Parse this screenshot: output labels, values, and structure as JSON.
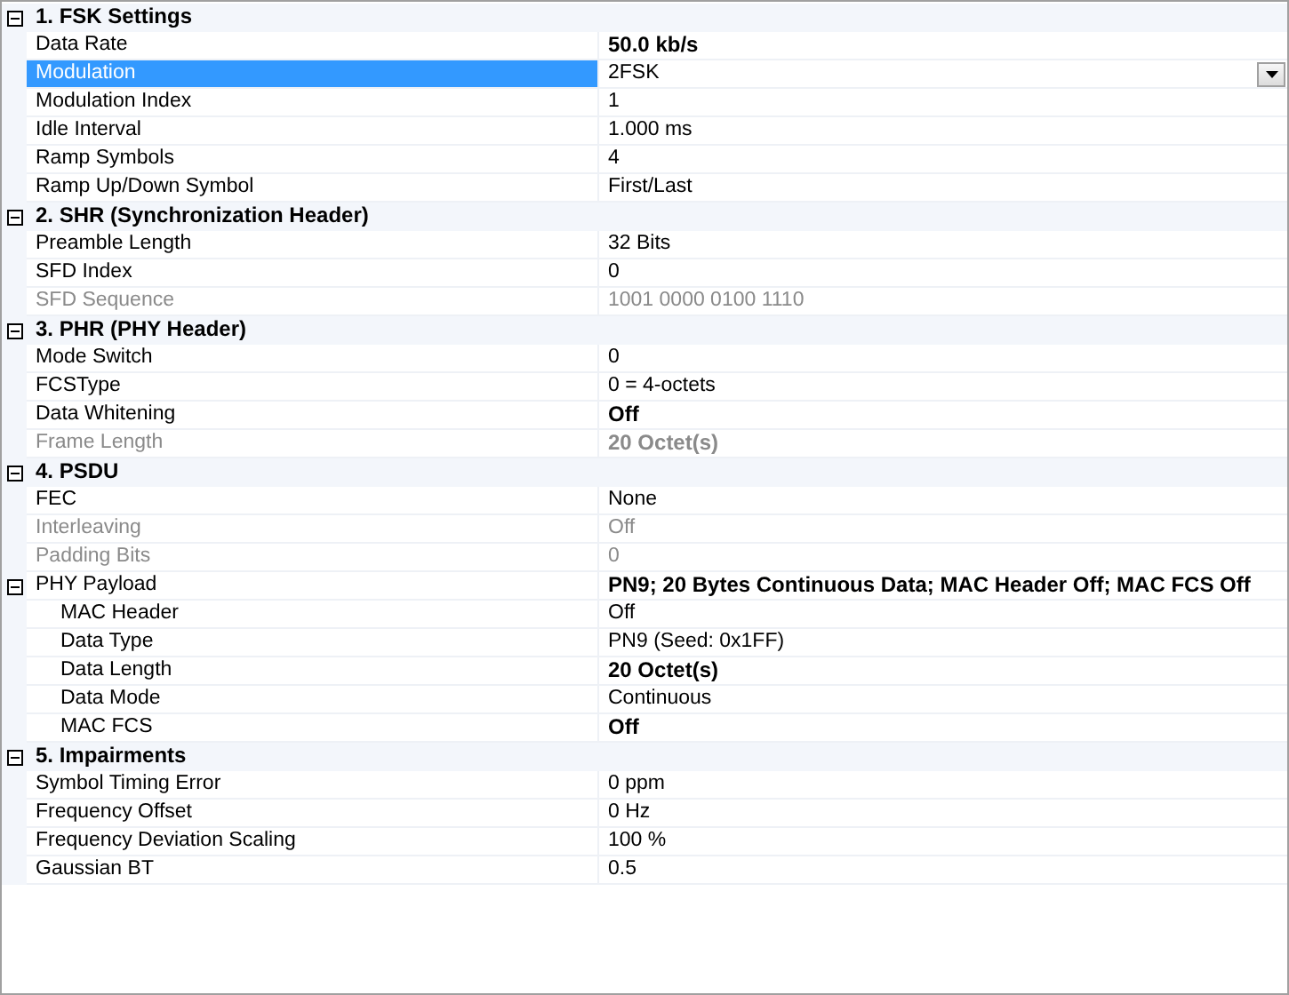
{
  "categories": [
    {
      "title": "1. FSK Settings",
      "expanded": true,
      "properties": [
        {
          "name": "Data Rate",
          "value": "50.0 kb/s",
          "bold": true,
          "disabled": false,
          "selected": false
        },
        {
          "name": "Modulation",
          "value": "2FSK",
          "bold": false,
          "disabled": false,
          "selected": true
        },
        {
          "name": "Modulation Index",
          "value": "1",
          "bold": false,
          "disabled": false,
          "selected": false
        },
        {
          "name": "Idle Interval",
          "value": "1.000 ms",
          "bold": false,
          "disabled": false,
          "selected": false
        },
        {
          "name": "Ramp Symbols",
          "value": "4",
          "bold": false,
          "disabled": false,
          "selected": false
        },
        {
          "name": "Ramp Up/Down Symbol",
          "value": "First/Last",
          "bold": false,
          "disabled": false,
          "selected": false
        }
      ]
    },
    {
      "title": "2. SHR (Synchronization Header)",
      "expanded": true,
      "properties": [
        {
          "name": "Preamble Length",
          "value": "32 Bits",
          "bold": false,
          "disabled": false,
          "selected": false
        },
        {
          "name": "SFD Index",
          "value": "0",
          "bold": false,
          "disabled": false,
          "selected": false
        },
        {
          "name": "SFD Sequence",
          "value": "1001 0000 0100 1110",
          "bold": false,
          "disabled": true,
          "selected": false
        }
      ]
    },
    {
      "title": "3. PHR (PHY Header)",
      "expanded": true,
      "properties": [
        {
          "name": "Mode Switch",
          "value": "0",
          "bold": false,
          "disabled": false,
          "selected": false
        },
        {
          "name": "FCSType",
          "value": "0 = 4-octets",
          "bold": false,
          "disabled": false,
          "selected": false
        },
        {
          "name": "Data Whitening",
          "value": "Off",
          "bold": true,
          "disabled": false,
          "selected": false
        },
        {
          "name": "Frame Length",
          "value": "20 Octet(s)",
          "bold": true,
          "disabled": true,
          "selected": false
        }
      ]
    },
    {
      "title": "4. PSDU",
      "expanded": true,
      "properties": [
        {
          "name": "FEC",
          "value": "None",
          "bold": false,
          "disabled": false,
          "selected": false
        },
        {
          "name": "Interleaving",
          "value": "Off",
          "bold": false,
          "disabled": true,
          "selected": false
        },
        {
          "name": "Padding Bits",
          "value": "0",
          "bold": false,
          "disabled": true,
          "selected": false
        },
        {
          "name": "PHY Payload",
          "value": "PN9; 20 Bytes Continuous Data; MAC Header Off; MAC FCS Off",
          "bold": true,
          "disabled": false,
          "selected": false,
          "expanded": true,
          "children": [
            {
              "name": "MAC Header",
              "value": "Off",
              "bold": false,
              "disabled": false,
              "selected": false
            },
            {
              "name": "Data Type",
              "value": "PN9 (Seed: 0x1FF)",
              "bold": false,
              "disabled": false,
              "selected": false
            },
            {
              "name": "Data Length",
              "value": "20 Octet(s)",
              "bold": true,
              "disabled": false,
              "selected": false
            },
            {
              "name": "Data Mode",
              "value": "Continuous",
              "bold": false,
              "disabled": false,
              "selected": false
            },
            {
              "name": "MAC FCS",
              "value": "Off",
              "bold": true,
              "disabled": false,
              "selected": false
            }
          ]
        }
      ]
    },
    {
      "title": "5. Impairments",
      "expanded": true,
      "properties": [
        {
          "name": "Symbol Timing Error",
          "value": "0 ppm",
          "bold": false,
          "disabled": false,
          "selected": false
        },
        {
          "name": "Frequency Offset",
          "value": "0 Hz",
          "bold": false,
          "disabled": false,
          "selected": false
        },
        {
          "name": "Frequency Deviation Scaling",
          "value": "100 %",
          "bold": false,
          "disabled": false,
          "selected": false
        },
        {
          "name": "Gaussian BT",
          "value": "0.5",
          "bold": false,
          "disabled": false,
          "selected": false
        }
      ]
    }
  ]
}
